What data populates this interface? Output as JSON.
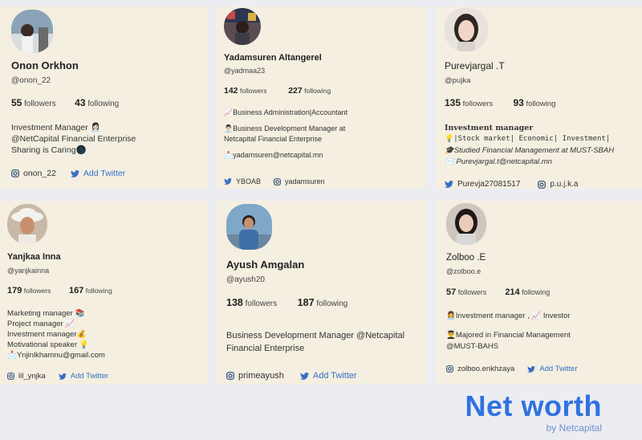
{
  "profiles": [
    {
      "name": "Onon Orkhon",
      "handle": "@onon_22",
      "followers": "55",
      "followers_label": "followers",
      "following": "43",
      "following_label": "following",
      "bio": [
        "Investment Manager 👩🏻‍💼",
        "@NetCapital Financial Enterprise",
        "Sharing is Caring🌑"
      ],
      "instagram": "onon_22",
      "twitter": "Add Twitter"
    },
    {
      "name": "Yadamsuren Altangerel",
      "handle": "@yadmaa23",
      "followers": "142",
      "followers_label": "followers",
      "following": "227",
      "following_label": "following",
      "bio": [
        "📈Business Administration|Accountant",
        "",
        "👨🏻‍💼Business Development Manager at",
        "Netcapital Financial Enterprise",
        "",
        "📩yadamsuren@netcapital.mn"
      ],
      "twitter": "YBOAB",
      "instagram": "yadamsuren"
    },
    {
      "name": "Purevjargal .T",
      "handle": "@pujka",
      "followers": "135",
      "followers_label": "followers",
      "following": "93",
      "following_label": "following",
      "bio": [
        "Investment manager",
        "💡|Stock market| Economic| Investment|",
        "🎓Studied Financial Management at MUST-SBAH",
        "✉️ Purevjargal.t@netcapital.mn"
      ],
      "twitter": "Purevja27081517",
      "instagram": "p.u.j.k.a"
    },
    {
      "name": "Yanjkaa Inna",
      "handle": "@yanjkainna",
      "followers": "179",
      "followers_label": "followers",
      "following": "167",
      "following_label": "following",
      "bio": [
        "Marketing manager 📚",
        "Project manager 📈",
        "Investment manager💰",
        "Motivational speaker 💡",
        "📩Ynjinlkhamnu@gmail.com"
      ],
      "instagram": "lil_ynjka",
      "twitter": "Add Twitter"
    },
    {
      "name": "Ayush Amgalan",
      "handle": "@ayush20",
      "followers": "138",
      "followers_label": "followers",
      "following": "187",
      "following_label": "following",
      "bio": [
        "Business Development Manager @Netcapital",
        "Financial Enterprise"
      ],
      "instagram": "primeayush",
      "twitter": "Add Twitter"
    },
    {
      "name": "Zolboo .E",
      "handle": "@zolboo.e",
      "followers": "57",
      "followers_label": "followers",
      "following": "214",
      "following_label": "following",
      "bio": [
        "👩‍💼Investment manager , 📈 Investor",
        "",
        "👨‍🎓Majored in Financial Management",
        "@MUST-BAHS"
      ],
      "instagram": "zolboo.enkhzaya",
      "twitter": "Add Twitter"
    }
  ],
  "brand": {
    "title": "Net worth",
    "subtitle": "by Netcapital"
  },
  "colors": {
    "card_bg": "#f4efe1",
    "page_bg": "#ecedf2",
    "accent": "#2f72e0",
    "twitter": "#3a6fc3"
  },
  "icons": {
    "instagram": "instagram-icon",
    "twitter": "twitter-icon"
  }
}
